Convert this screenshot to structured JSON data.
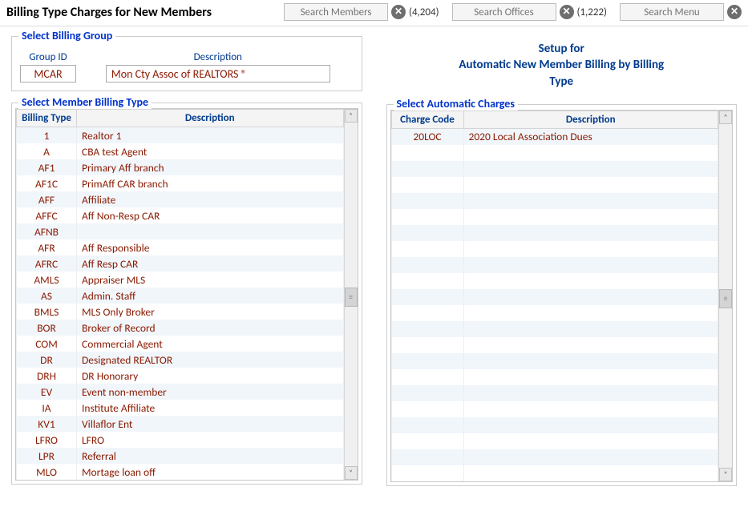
{
  "header": {
    "title": "Billing Type Charges for New Members",
    "search_members_placeholder": "Search Members",
    "members_count": "(4,204)",
    "search_offices_placeholder": "Search Offices",
    "offices_count": "(1,222)",
    "search_menu_placeholder": "Search Menu"
  },
  "billing_group": {
    "legend": "Select Billing Group",
    "group_id_label": "Group ID",
    "description_label": "Description",
    "group_id_value": "MCAR",
    "description_value": "Mon Cty Assoc of REALTORS ®"
  },
  "setup_header": {
    "line1": "Setup for",
    "line2": "Automatic New Member Billing by Billing",
    "line3": "Type"
  },
  "billing_types": {
    "legend": "Select Member Billing Type",
    "col_code": "Billing Type",
    "col_desc": "Description",
    "rows": [
      {
        "code": "1",
        "desc": "Realtor 1"
      },
      {
        "code": "A",
        "desc": "CBA test Agent"
      },
      {
        "code": "AF1",
        "desc": "Primary Aff branch"
      },
      {
        "code": "AF1C",
        "desc": "PrimAff CAR branch"
      },
      {
        "code": "AFF",
        "desc": "Affiliate"
      },
      {
        "code": "AFFC",
        "desc": "Aff Non-Resp CAR"
      },
      {
        "code": "AFNB",
        "desc": ""
      },
      {
        "code": "AFR",
        "desc": "Aff Responsible"
      },
      {
        "code": "AFRC",
        "desc": "Aff Resp CAR"
      },
      {
        "code": "AMLS",
        "desc": "Appraiser MLS"
      },
      {
        "code": "AS",
        "desc": "Admin. Staff"
      },
      {
        "code": "BMLS",
        "desc": "MLS Only Broker"
      },
      {
        "code": "BOR",
        "desc": "Broker of Record"
      },
      {
        "code": "COM",
        "desc": "Commercial Agent"
      },
      {
        "code": "DR",
        "desc": "Designated REALTOR"
      },
      {
        "code": "DRH",
        "desc": "DR Honorary"
      },
      {
        "code": "EV",
        "desc": "Event non-member"
      },
      {
        "code": "IA",
        "desc": "Institute Affiliate"
      },
      {
        "code": "KV1",
        "desc": "Villaflor Ent"
      },
      {
        "code": "LFRO",
        "desc": "LFRO"
      },
      {
        "code": "LPR",
        "desc": "Referral"
      },
      {
        "code": "MLO",
        "desc": "Mortage loan off"
      }
    ]
  },
  "charges": {
    "legend": "Select Automatic Charges",
    "col_code": "Charge Code",
    "col_desc": "Description",
    "rows": [
      {
        "code": "20LOC",
        "desc": "2020 Local Association Dues"
      },
      {
        "code": "",
        "desc": ""
      },
      {
        "code": "",
        "desc": ""
      },
      {
        "code": "",
        "desc": ""
      },
      {
        "code": "",
        "desc": ""
      },
      {
        "code": "",
        "desc": ""
      },
      {
        "code": "",
        "desc": ""
      },
      {
        "code": "",
        "desc": ""
      },
      {
        "code": "",
        "desc": ""
      },
      {
        "code": "",
        "desc": ""
      },
      {
        "code": "",
        "desc": ""
      },
      {
        "code": "",
        "desc": ""
      },
      {
        "code": "",
        "desc": ""
      },
      {
        "code": "",
        "desc": ""
      },
      {
        "code": "",
        "desc": ""
      },
      {
        "code": "",
        "desc": ""
      },
      {
        "code": "",
        "desc": ""
      },
      {
        "code": "",
        "desc": ""
      },
      {
        "code": "",
        "desc": ""
      },
      {
        "code": "",
        "desc": ""
      },
      {
        "code": "",
        "desc": ""
      },
      {
        "code": "",
        "desc": ""
      }
    ]
  }
}
